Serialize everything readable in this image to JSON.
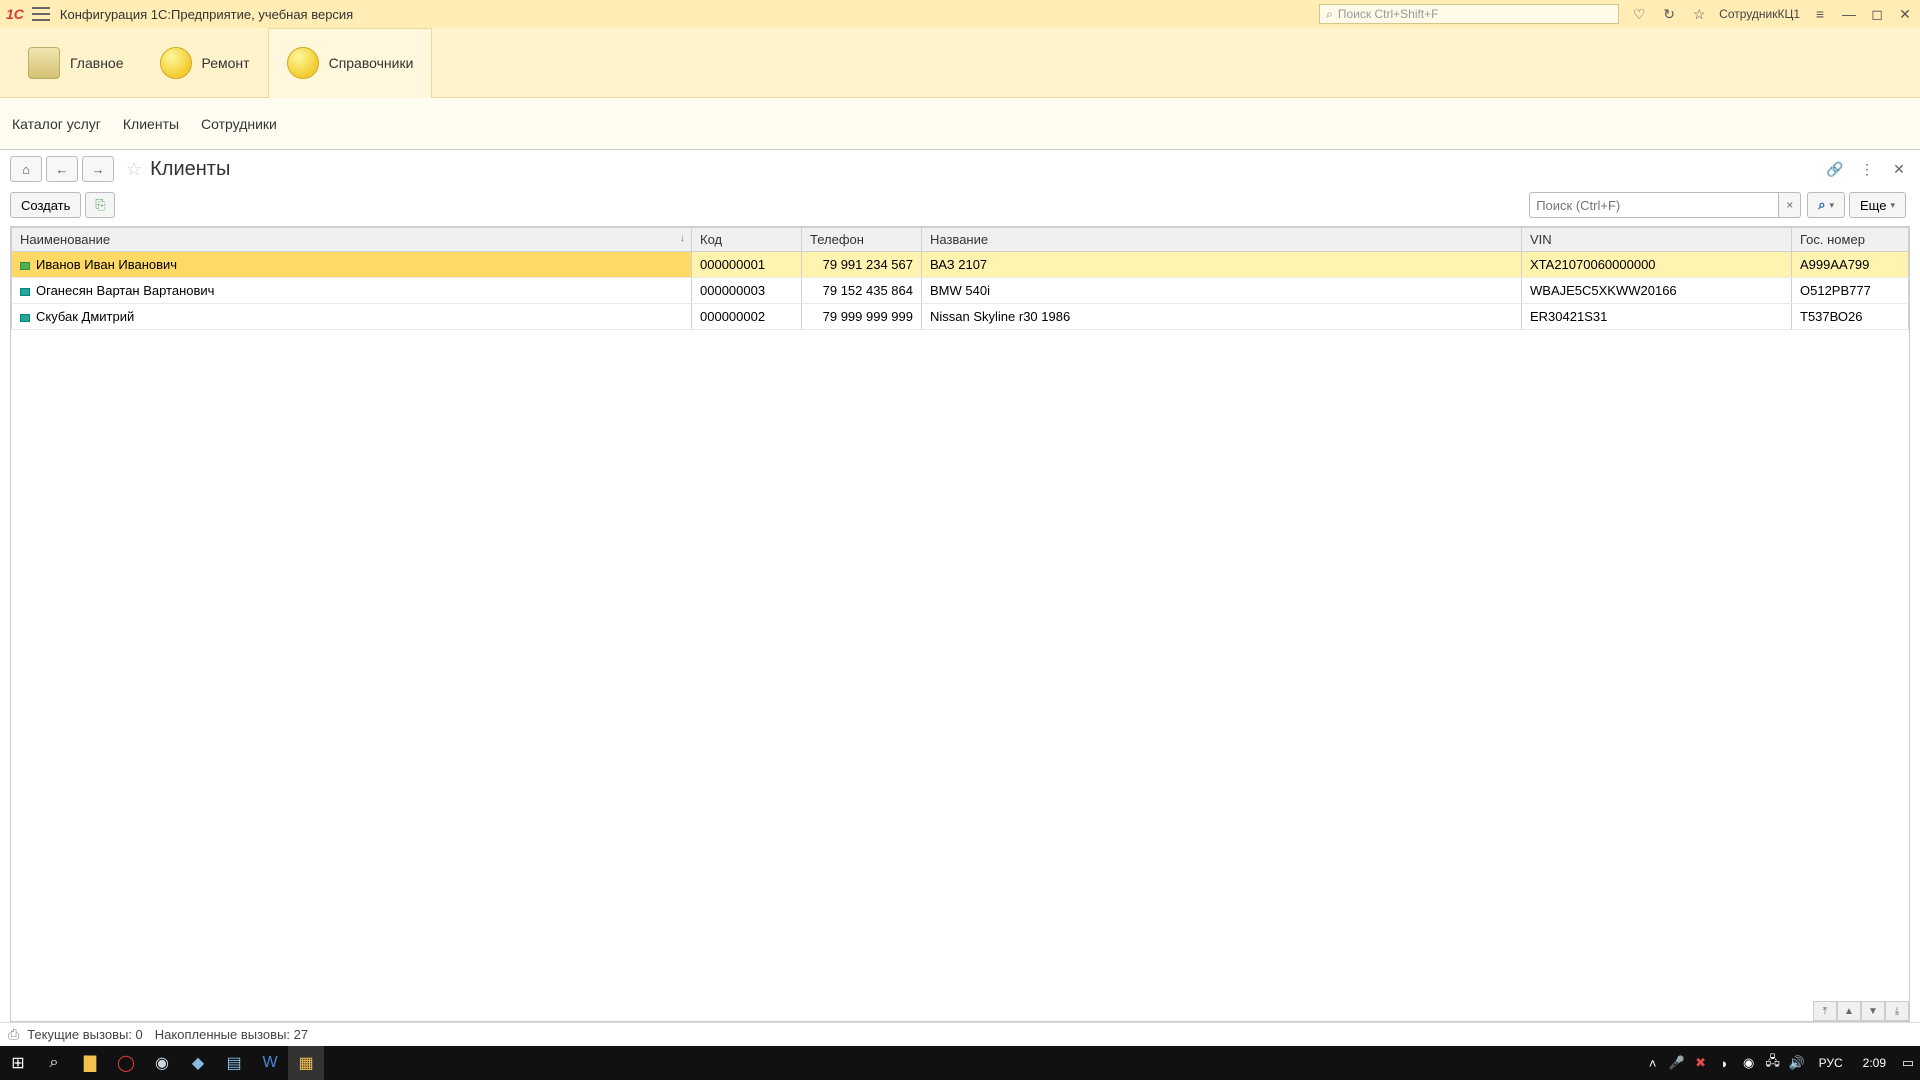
{
  "titlebar": {
    "logo": "1C",
    "title": "Конфигурация 1С:Предприятие, учебная версия",
    "search_placeholder": "Поиск Ctrl+Shift+F",
    "username": "СотрудникКЦ1"
  },
  "sections": {
    "main": "Главное",
    "repair": "Ремонт",
    "refs": "Справочники"
  },
  "submenu": {
    "catalog": "Каталог услуг",
    "clients": "Клиенты",
    "employees": "Сотрудники"
  },
  "page": {
    "title": "Клиенты",
    "create": "Создать",
    "filter_placeholder": "Поиск (Ctrl+F)",
    "more": "Еще"
  },
  "columns": {
    "name": "Наименование",
    "code": "Код",
    "phone": "Телефон",
    "carname": "Название",
    "vin": "VIN",
    "plate": "Гос. номер"
  },
  "rows": [
    {
      "name": "Иванов Иван Иванович",
      "code": "000000001",
      "phone": "79 991 234 567",
      "carname": "ВАЗ 2107",
      "vin": "XTA21070060000000",
      "plate": "А999АА799"
    },
    {
      "name": "Оганесян Вартан Вартанович",
      "code": "000000003",
      "phone": "79 152 435 864",
      "carname": "BMW 540i",
      "vin": "WBAJE5C5XKWW20166",
      "plate": "О512РВ777"
    },
    {
      "name": "Скубак Дмитрий",
      "code": "000000002",
      "phone": "79 999 999 999",
      "carname": "Nissan Skyline r30 1986",
      "vin": "ER30421S31",
      "plate": "Т537ВО26"
    }
  ],
  "statusbar": {
    "current": "Текущие вызовы: 0",
    "queued": "Накопленные вызовы: 27"
  },
  "taskbar": {
    "lang": "РУС",
    "time": "2:09"
  }
}
